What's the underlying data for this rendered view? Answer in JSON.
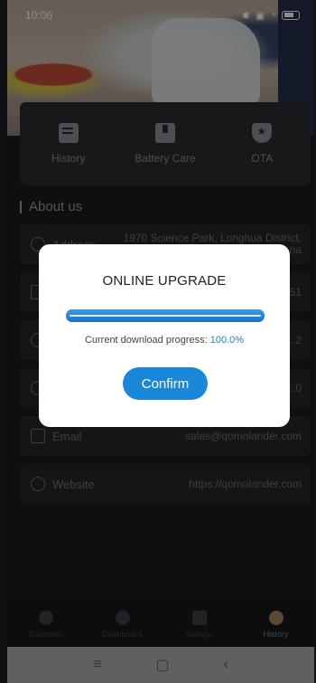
{
  "status_bar": {
    "time": "10:06",
    "alarm_icon": "alarm-off-icon",
    "icons": [
      "bluetooth-icon",
      "sim-icon",
      "wifi-icon",
      "battery-icon"
    ]
  },
  "features": [
    {
      "label": "History",
      "icon": "history-icon"
    },
    {
      "label": "Battery Care",
      "icon": "battery-care-icon"
    },
    {
      "label": "OTA",
      "icon": "shield-star-icon"
    }
  ],
  "about": {
    "title": "About us",
    "rows": [
      {
        "label": "Address",
        "value_line1": "1970 Science Park, Longhua District,",
        "value_line2": "...na",
        "icon": "location-icon"
      },
      {
        "label": "",
        "value_line1": "...51",
        "value_line2": "",
        "icon": "document-icon"
      },
      {
        "label": "",
        "value_line1": "...2",
        "value_line2": "",
        "icon": "tag-icon"
      },
      {
        "label": "",
        "value_line1": "...0",
        "value_line2": "",
        "icon": "tag-icon"
      },
      {
        "label": "Email",
        "value_line1": "sales@qomolander.com",
        "value_line2": "",
        "icon": "mail-icon"
      },
      {
        "label": "Website",
        "value_line1": "https://qomolander.com",
        "value_line2": "",
        "icon": "globe-icon"
      }
    ]
  },
  "bottom_nav": [
    {
      "label": "Bluetooth",
      "icon": "bluetooth-icon",
      "active": false
    },
    {
      "label": "Dashboard",
      "icon": "dashboard-icon",
      "active": false
    },
    {
      "label": "Voltage",
      "icon": "voltage-icon",
      "active": false
    },
    {
      "label": "History",
      "icon": "person-icon",
      "active": true
    }
  ],
  "system_nav": {
    "menu": "≡",
    "home": "▢",
    "back": "‹"
  },
  "dialog": {
    "title": "ONLINE UPGRADE",
    "progress_label": "Current download progress: ",
    "progress_value": "100.0%",
    "progress_fraction": 1.0,
    "confirm_label": "Confirm"
  },
  "colors": {
    "accent": "#1b87d8",
    "active_nav": "#a8855e"
  }
}
